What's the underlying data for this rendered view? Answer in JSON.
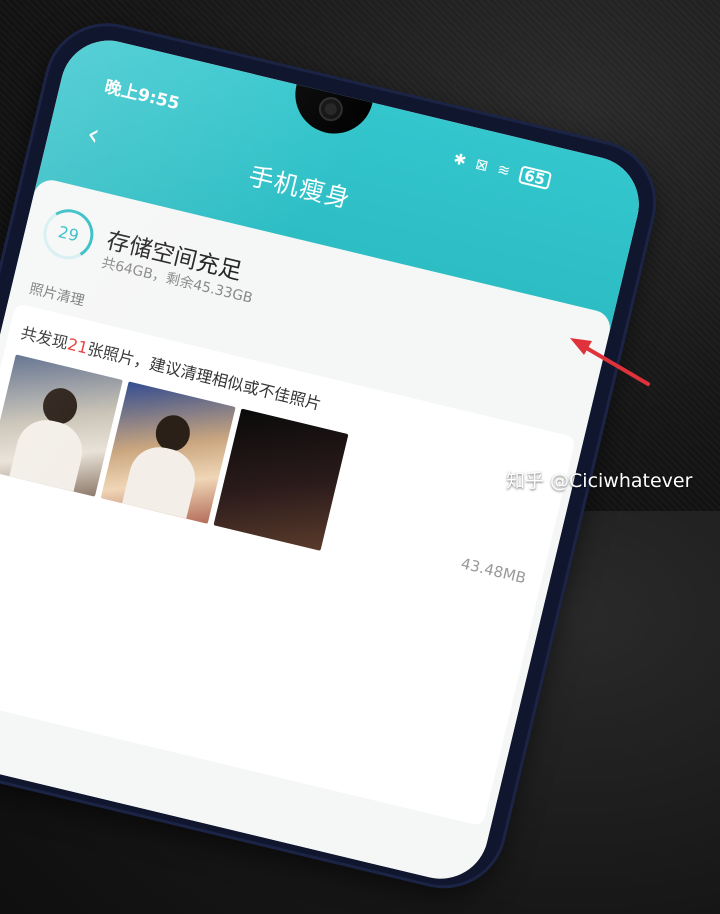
{
  "status_bar": {
    "time": "晚上9:55",
    "battery": "65"
  },
  "header": {
    "back_icon": "chevron-left-icon",
    "title": "手机瘦身",
    "settings_icon": "gear-icon"
  },
  "storage": {
    "score": "29",
    "title": "存储空间充足",
    "subtitle": "共64GB，剩余45.33GB"
  },
  "photo_section": {
    "label": "照片清理",
    "found_prefix": "共发现",
    "found_count": "21",
    "found_suffix": "张照片，建议清理相似或不佳照片",
    "size": "43.48MB"
  },
  "watermark": "知乎 @Ciciwhatever",
  "colors": {
    "accent": "#2cbcc3",
    "highlight": "#ea3b3b",
    "arrow": "#e0323a"
  }
}
